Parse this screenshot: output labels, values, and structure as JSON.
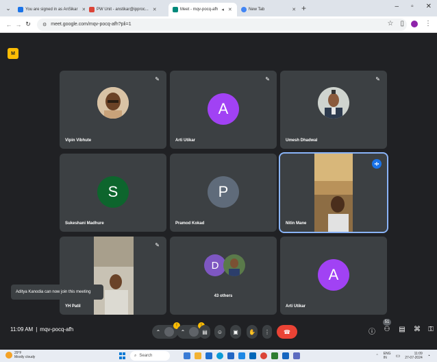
{
  "browser": {
    "tabs": [
      {
        "title": "You are signed in as AnSikar",
        "icon_color": "#1a73e8",
        "active": false
      },
      {
        "title": "PW Unit - anstikar@ipproc...",
        "icon_color": "#db4437",
        "active": false
      },
      {
        "title": "Meet - mqv-pocq-afh",
        "icon_color": "#00897b",
        "active": true
      },
      {
        "title": "New Tab",
        "icon_color": "#4285f4",
        "active": false
      }
    ],
    "url": "meet.google.com/mqv-pocq-afh?pli=1"
  },
  "tiles": [
    {
      "name": "Vipin Vibhute",
      "kind": "photo"
    },
    {
      "name": "Arti Utikar",
      "kind": "letter",
      "letter": "A",
      "color": "#a142f4"
    },
    {
      "name": "Umesh Dhadwal",
      "kind": "photo"
    },
    {
      "name": "Sukeshani Madhure",
      "kind": "letter",
      "letter": "S",
      "color": "#0d652d"
    },
    {
      "name": "Pramod Kokad",
      "kind": "letter",
      "letter": "P",
      "color": "#5f6b7a"
    },
    {
      "name": "Nitin Mane",
      "kind": "video"
    },
    {
      "name": "YH Patil",
      "kind": "video"
    },
    {
      "name": "43 others",
      "kind": "group",
      "letter": "D",
      "color": "#7e57c2"
    },
    {
      "name": "Arti Utikar",
      "kind": "letter",
      "letter": "A",
      "color": "#a142f4"
    }
  ],
  "toast": "Aditya Kanodia can now join this meeting",
  "meeting": {
    "time": "11:09 AM",
    "separator": "|",
    "code": "mqv-pocq-afh",
    "people_count": "51"
  },
  "taskbar": {
    "weather_temp": "29°F",
    "weather_desc": "Mostly cloudy",
    "search": "Search",
    "lang": "ENG",
    "region": "IN",
    "time": "11:09",
    "date": "27-07-2024"
  },
  "colors": {
    "meet_bg": "#202124",
    "tile_bg": "#3c4043",
    "end_call": "#ea4335",
    "accent": "#8ab4f8"
  }
}
